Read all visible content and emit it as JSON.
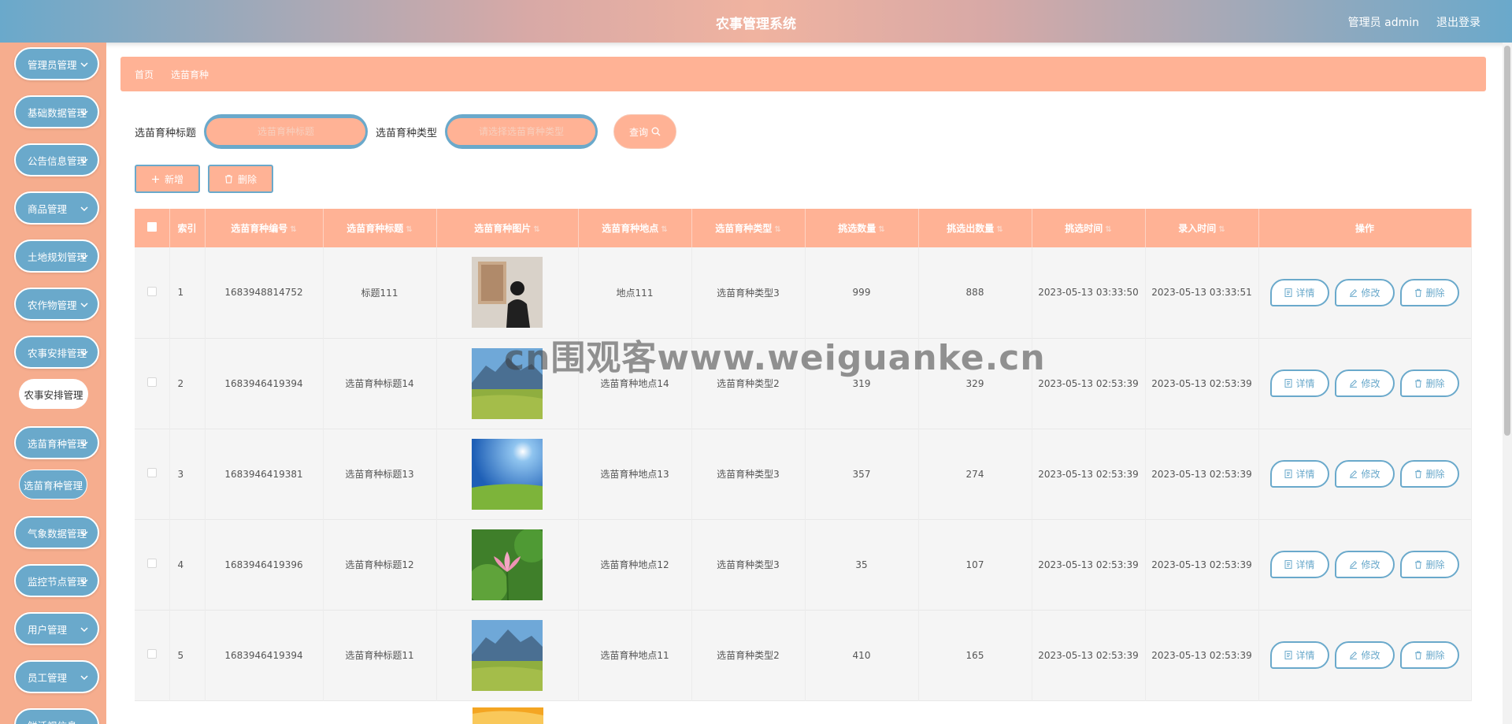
{
  "header": {
    "title": "农事管理系统",
    "user": "管理员 admin",
    "logout": "退出登录"
  },
  "sidebar": {
    "items": [
      {
        "label": "管理员管理"
      },
      {
        "label": "基础数据管理"
      },
      {
        "label": "公告信息管理"
      },
      {
        "label": "商品管理"
      },
      {
        "label": "土地规划管理"
      },
      {
        "label": "农作物管理"
      },
      {
        "label": "农事安排管理"
      },
      {
        "label": "农事安排管理"
      },
      {
        "label": "选苗育种管理"
      },
      {
        "label": "选苗育种管理"
      },
      {
        "label": "气象数据管理"
      },
      {
        "label": "监控节点管理"
      },
      {
        "label": "用户管理"
      },
      {
        "label": "员工管理"
      },
      {
        "label": "鲜活视信息"
      }
    ]
  },
  "breadcrumb": {
    "home": "首页",
    "current": "选苗育种"
  },
  "search": {
    "title_label": "选苗育种标题",
    "title_placeholder": "选苗育种标题",
    "type_label": "选苗育种类型",
    "type_placeholder": "请选择选苗育种类型",
    "query": "查询"
  },
  "actions": {
    "add": "新增",
    "delete": "删除"
  },
  "table": {
    "headers": [
      "索引",
      "选苗育种编号",
      "选苗育种标题",
      "选苗育种图片",
      "选苗育种地点",
      "选苗育种类型",
      "挑选数量",
      "挑选出数量",
      "挑选时间",
      "录入时间",
      "操作"
    ],
    "rows": [
      {
        "index": "1",
        "code": "1683948814752",
        "title": "标题111",
        "place": "地点111",
        "type": "选苗育种类型3",
        "count": "999",
        "picked": "888",
        "pick_time": "2023-05-13 03:33:50",
        "entry_time": "2023-05-13 03:33:51"
      },
      {
        "index": "2",
        "code": "1683946419394",
        "title": "选苗育种标题14",
        "place": "选苗育种地点14",
        "type": "选苗育种类型2",
        "count": "319",
        "picked": "329",
        "pick_time": "2023-05-13 02:53:39",
        "entry_time": "2023-05-13 02:53:39"
      },
      {
        "index": "3",
        "code": "1683946419381",
        "title": "选苗育种标题13",
        "place": "选苗育种地点13",
        "type": "选苗育种类型3",
        "count": "357",
        "picked": "274",
        "pick_time": "2023-05-13 02:53:39",
        "entry_time": "2023-05-13 02:53:39"
      },
      {
        "index": "4",
        "code": "1683946419396",
        "title": "选苗育种标题12",
        "place": "选苗育种地点12",
        "type": "选苗育种类型3",
        "count": "35",
        "picked": "107",
        "pick_time": "2023-05-13 02:53:39",
        "entry_time": "2023-05-13 02:53:39"
      },
      {
        "index": "5",
        "code": "1683946419394",
        "title": "选苗育种标题11",
        "place": "选苗育种地点11",
        "type": "选苗育种类型2",
        "count": "410",
        "picked": "165",
        "pick_time": "2023-05-13 02:53:39",
        "entry_time": "2023-05-13 02:53:39"
      }
    ],
    "ops": {
      "detail": "详情",
      "edit": "修改",
      "delete": "删除"
    }
  },
  "watermark": "cn围观客www.weiguanke.cn",
  "colors": {
    "primary_blue": "#6aa9cb",
    "accent_peach": "#ffb295",
    "sidebar_bg": "#f6ad8e"
  },
  "icons": {
    "query": "search-icon",
    "add": "plus-icon",
    "delete": "trash-icon",
    "detail": "document-icon",
    "edit": "pencil-icon",
    "menu": "chevron-down-icon"
  }
}
